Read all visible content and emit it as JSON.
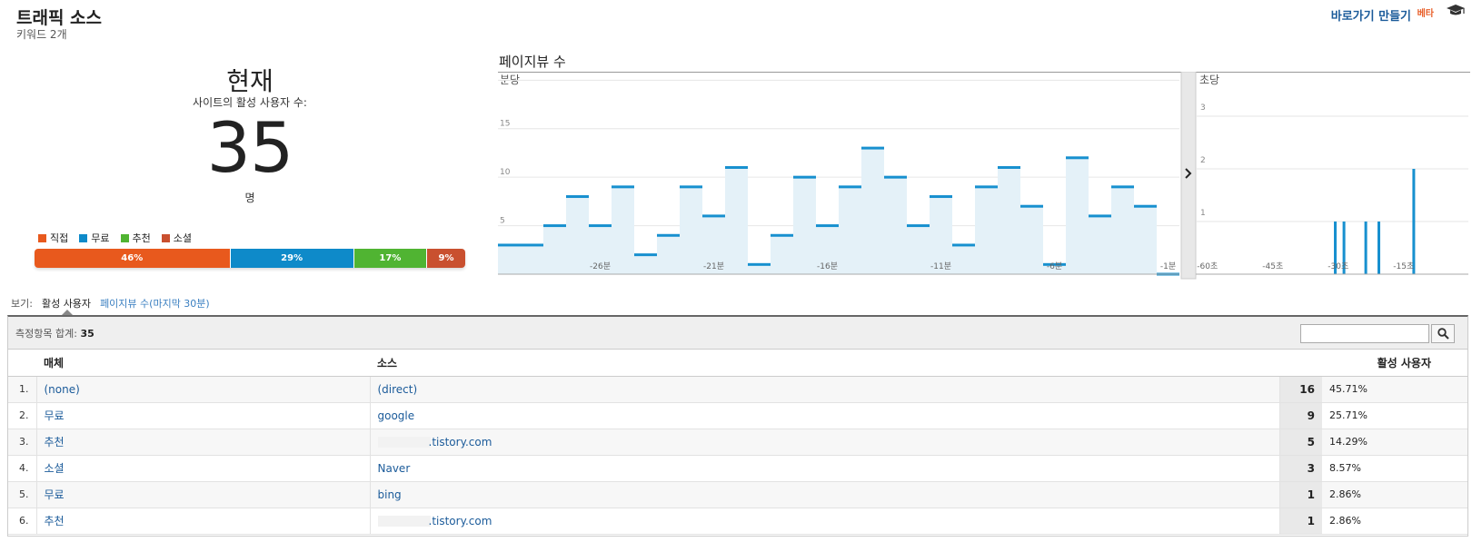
{
  "header": {
    "title": "트래픽 소스",
    "subtitle": "키워드 2개",
    "shortcut_label": "바로가기 만들기",
    "beta_label": "베타",
    "cap_icon": "graduation-cap-icon"
  },
  "summary": {
    "now_label": "현재",
    "active_label": "사이트의 활성 사용자 수:",
    "active_count": "35",
    "unit_label": "명"
  },
  "legend": [
    {
      "label": "직접",
      "color": "#e8591d"
    },
    {
      "label": "무료",
      "color": "#0e8ac9"
    },
    {
      "label": "추천",
      "color": "#50b432"
    },
    {
      "label": "소셜",
      "color": "#c9502f"
    }
  ],
  "segments": [
    {
      "label": "46%",
      "value": 46,
      "color": "#e8591d"
    },
    {
      "label": "29%",
      "value": 29,
      "color": "#0e8ac9"
    },
    {
      "label": "17%",
      "value": 17,
      "color": "#50b432"
    },
    {
      "label": "9%",
      "value": 9,
      "color": "#c9502f"
    }
  ],
  "chart_title": "페이지뷰 수",
  "chart_data": [
    {
      "type": "bar",
      "panel": "분당",
      "ylim": [
        0,
        19
      ],
      "yticks": [
        5,
        10,
        15
      ],
      "xtick_labels": [
        "-26분",
        "-21분",
        "-16분",
        "-11분",
        "-6분",
        "-1분"
      ],
      "xtick_positions": [
        26,
        21,
        16,
        11,
        6,
        1
      ],
      "x": [
        30,
        29,
        28,
        27,
        26,
        25,
        24,
        23,
        22,
        21,
        20,
        19,
        18,
        17,
        16,
        15,
        14,
        13,
        12,
        11,
        10,
        9,
        8,
        7,
        6,
        5,
        4,
        3,
        2,
        1
      ],
      "values": [
        3,
        3,
        5,
        8,
        5,
        9,
        2,
        4,
        9,
        6,
        11,
        1,
        4,
        10,
        5,
        9,
        13,
        10,
        5,
        8,
        3,
        9,
        11,
        7,
        1,
        12,
        6,
        9,
        7,
        0
      ]
    },
    {
      "type": "bar",
      "panel": "초당",
      "ylim": [
        0,
        3.5
      ],
      "yticks": [
        1,
        2,
        3
      ],
      "xtick_labels": [
        "-60초",
        "-45초",
        "-30초",
        "-15초"
      ],
      "xtick_positions": [
        60,
        45,
        30,
        15
      ],
      "x": [
        31,
        29,
        24,
        21,
        13
      ],
      "values": [
        1,
        1,
        1,
        1,
        2
      ]
    }
  ],
  "view": {
    "label": "보기:",
    "active": "활성 사용자",
    "link": "페이지뷰 수(마지막 30분)"
  },
  "table": {
    "total_label": "측정항목 합계:",
    "total_value": "35",
    "columns": [
      "매체",
      "소스",
      "활성 사용자"
    ],
    "rows": [
      {
        "idx": "1.",
        "medium": "(none)",
        "source": "(direct)",
        "count": "16",
        "pct": "45.71%"
      },
      {
        "idx": "2.",
        "medium": "무료",
        "source": "google",
        "count": "9",
        "pct": "25.71%"
      },
      {
        "idx": "3.",
        "medium": "추천",
        "source": ".tistory.com",
        "count": "5",
        "pct": "14.29%"
      },
      {
        "idx": "4.",
        "medium": "소셜",
        "source": "Naver",
        "count": "3",
        "pct": "8.57%"
      },
      {
        "idx": "5.",
        "medium": "무료",
        "source": "bing",
        "count": "1",
        "pct": "2.86%"
      },
      {
        "idx": "6.",
        "medium": "추천",
        "source": ".tistory.com",
        "count": "1",
        "pct": "2.86%"
      }
    ]
  },
  "search": {
    "placeholder": "",
    "icon": "search-icon"
  }
}
